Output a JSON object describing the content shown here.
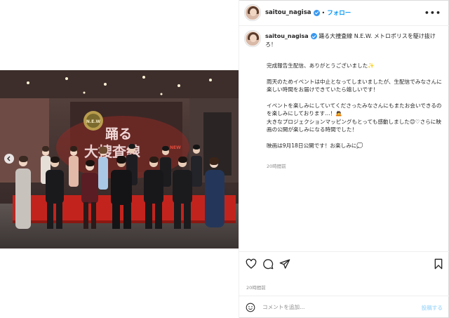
{
  "post": {
    "username": "saitou_nagisa",
    "follow_label": "フォロー",
    "more_label": "•••",
    "dot": "•"
  },
  "caption": {
    "title": "踊る大捜査線 N.E.W. メトロポリスを駆け抜けろ！",
    "body": "完成報告生配信、ありがとうございました✨\n\n雨天のためイベントは中止となってしまいましたが、生配信でみなさんに楽しい時間をお届けできていたら嬉しいです！\n\nイベントを楽しみにしていてくださったみなさんにもまたお会いできるのを楽しみにしております…！🙇\n大きなプロジェクションマッピングもとっても感動しました😊♡さらに映画の公開が楽しみになる時間でした！\n\n映画は9月18日公開です！お楽しみに💭",
    "time": "20時間前"
  },
  "footer": {
    "post_time": "20時間前",
    "comment_placeholder": "コメントを追加...",
    "post_label": "投稿する"
  },
  "photo_sign": {
    "logo": "N.E.W",
    "title_line1": "踊る",
    "title_line2": "大捜査線",
    "tag": "NEW"
  },
  "icons": [
    "more-icon",
    "verified-icon",
    "chevron-left-icon",
    "heart-icon",
    "comment-icon",
    "share-icon",
    "bookmark-icon",
    "emoji-icon"
  ],
  "colors": {
    "accent": "#0095f6",
    "verified": "#3897f0",
    "muted": "#8e8e8e",
    "stage_red": "#c2241d"
  }
}
